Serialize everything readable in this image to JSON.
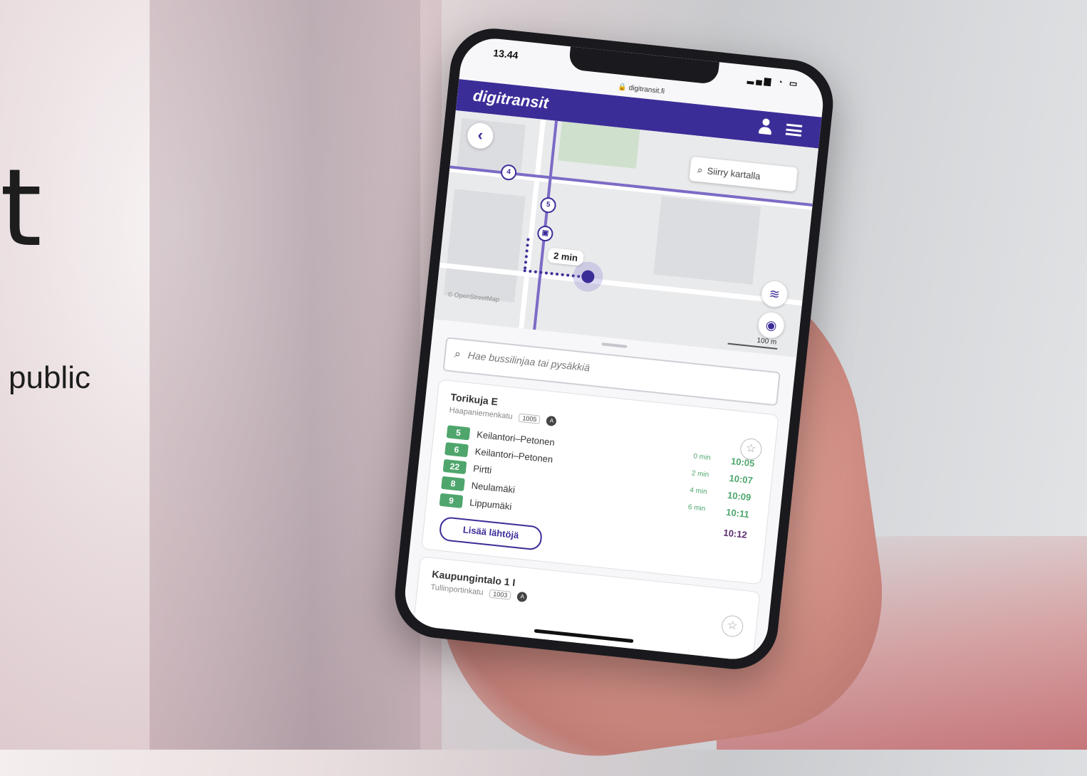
{
  "backdrop": {
    "big_letter": "t",
    "partial_word": "public"
  },
  "phone": {
    "status": {
      "time": "13.44",
      "icons": "signal-wifi-battery"
    },
    "url": "🔒 digitransit.fi",
    "app": {
      "logo": "digitransit"
    },
    "map": {
      "search_placeholder": "Siirry kartalla",
      "route_markers": [
        "4",
        "5"
      ],
      "walk_time": "2 min",
      "attribution": "© OpenStreetMap",
      "scale": "100 m"
    },
    "stop_search": {
      "placeholder": "Hae bussilinjaa tai pysäkkiä"
    },
    "stops": [
      {
        "name": "Torikuja E",
        "street": "Haapaniemenkatu",
        "code": "1005",
        "mode": "A",
        "departures": [
          {
            "route": "5",
            "destination": "Keilantori–Petonen",
            "minutes": "0 min",
            "time": "10:05"
          },
          {
            "route": "6",
            "destination": "Keilantori–Petonen",
            "minutes": "2 min",
            "time": "10:07"
          },
          {
            "route": "22",
            "destination": "Pirtti",
            "minutes": "4 min",
            "time": "10:09"
          },
          {
            "route": "8",
            "destination": "Neulamäki",
            "minutes": "6 min",
            "time": "10:11"
          },
          {
            "route": "9",
            "destination": "Lippumäki",
            "minutes": "",
            "time": ""
          }
        ],
        "extra_time": "10:12",
        "more_label": "Lisää lähtöjä"
      },
      {
        "name": "Kaupungintalo 1 I",
        "street": "Tullinportinkatu",
        "code": "1003",
        "mode": "A"
      }
    ]
  },
  "colors": {
    "brand": "#3b2d98",
    "route": "#4fa66d"
  }
}
